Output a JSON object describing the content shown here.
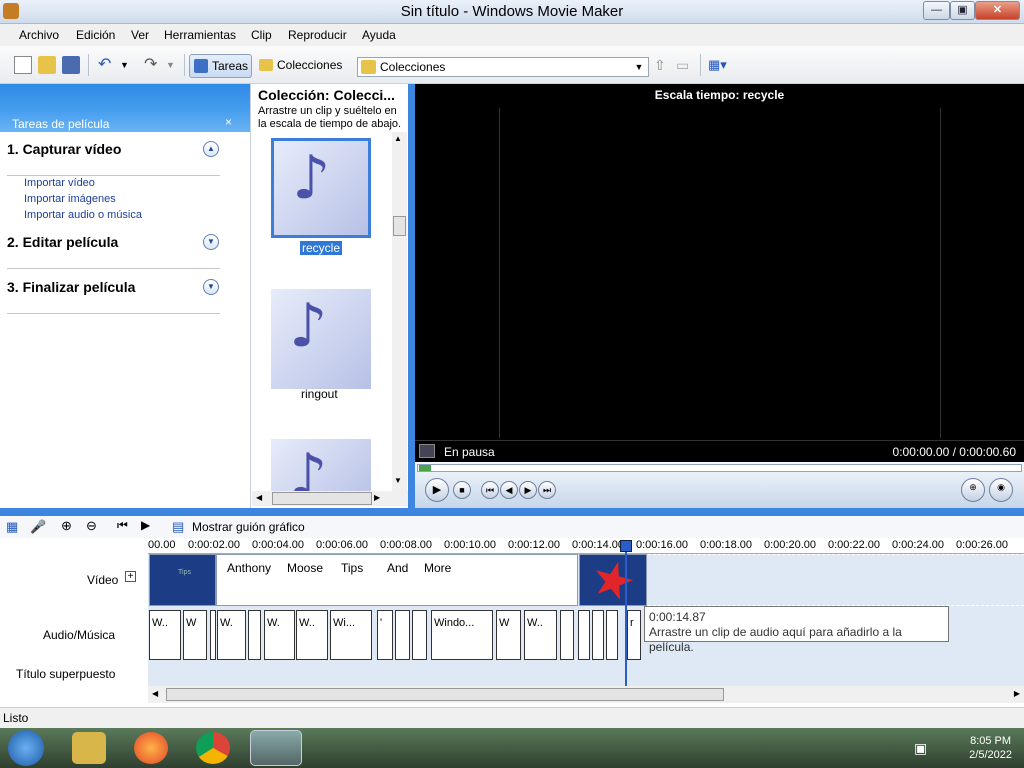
{
  "window": {
    "title": "Sin título - Windows Movie Maker"
  },
  "menu": [
    "Archivo",
    "Edición",
    "Ver",
    "Herramientas",
    "Clip",
    "Reproducir",
    "Ayuda"
  ],
  "toolbar": {
    "tasks_label": "Tareas",
    "collections_label": "Colecciones",
    "collection_select": "Colecciones"
  },
  "tasks": {
    "header": "Tareas de película",
    "close": "×",
    "s1": "1. Capturar vídeo",
    "s1_links": [
      "Importar vídeo",
      "Importar imágenes",
      "Importar audio o música"
    ],
    "s2": "2. Editar película",
    "s3": "3. Finalizar película"
  },
  "collection": {
    "title": "Colección: Colecci...",
    "desc": "Arrastre un clip y suéltelo en la escala de tiempo de abajo.",
    "items": [
      "recycle",
      "ringout"
    ]
  },
  "preview": {
    "title": "Escala tiempo: recycle",
    "status": "En pausa",
    "time": "0:00:00.00 / 0:00:00.60"
  },
  "timeline": {
    "show_storyboard": "Mostrar guión gráfico",
    "ticks": [
      "00.00",
      "0:00:02.00",
      "0:00:04.00",
      "0:00:06.00",
      "0:00:08.00",
      "0:00:10.00",
      "0:00:12.00",
      "0:00:14.00",
      "0:00:16.00",
      "0:00:18.00",
      "0:00:20.00",
      "0:00:22.00",
      "0:00:24.00",
      "0:00:26.00"
    ],
    "video_label": "Vídeo",
    "audio_label": "Audio/Música",
    "title_label": "Título superpuesto",
    "video_clips": [
      "Tips",
      "Anthony",
      "Moose",
      "Tips",
      "And",
      "More"
    ],
    "audio_clips": [
      "W..",
      "W",
      "W.",
      "W.",
      "W..",
      "Wi...",
      "'",
      "",
      "",
      "Windo...",
      "W",
      "W..",
      "",
      "",
      "",
      "",
      "r"
    ],
    "tooltip_time": "0:00:14.87",
    "tooltip_text": "Arrastre un clip de audio aquí para añadirlo a la película."
  },
  "statusbar": "Listo",
  "clock": {
    "time": "8:05 PM",
    "date": "2/5/2022"
  }
}
